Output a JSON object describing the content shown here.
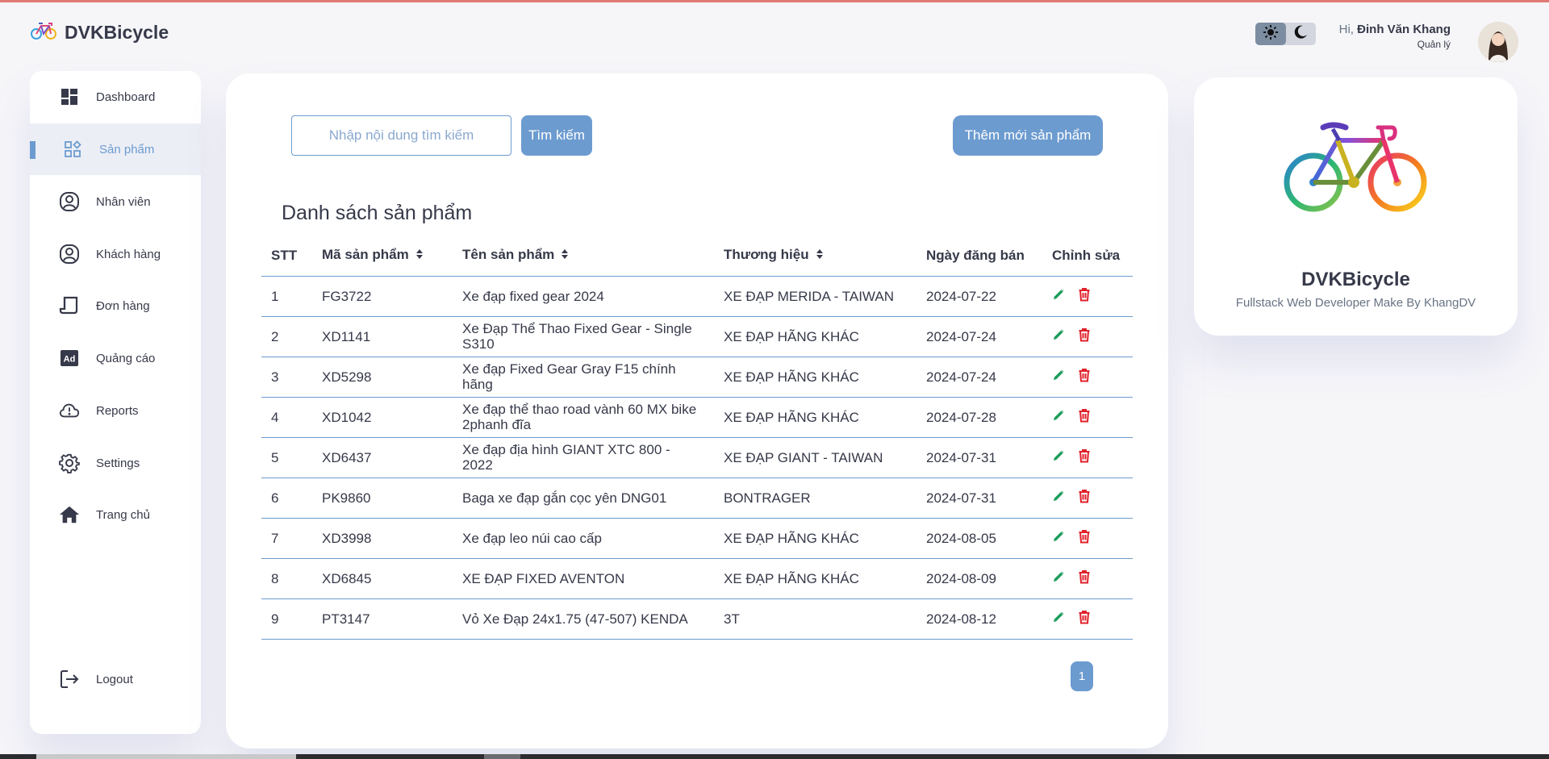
{
  "brand": {
    "title": "DVKBicycle"
  },
  "header": {
    "greeting_prefix": "Hi,",
    "user_name": "Đinh Văn Khang",
    "role": "Quản lý"
  },
  "sidebar": {
    "items": [
      {
        "label": "Dashboard",
        "icon": "dashboard-icon"
      },
      {
        "label": "Sản phẩm",
        "icon": "widgets-icon",
        "active": true
      },
      {
        "label": "Nhân viên",
        "icon": "person-icon"
      },
      {
        "label": "Khách hàng",
        "icon": "person-icon"
      },
      {
        "label": "Đơn hàng",
        "icon": "receipt-icon"
      },
      {
        "label": "Quảng cáo",
        "icon": "ad-icon"
      },
      {
        "label": "Reports",
        "icon": "report-cloud-icon"
      },
      {
        "label": "Settings",
        "icon": "gear-icon"
      },
      {
        "label": "Trang chủ",
        "icon": "home-icon"
      }
    ],
    "logout": "Logout"
  },
  "main": {
    "search_placeholder": "Nhập nội dung tìm kiếm",
    "search_button": "Tìm kiếm",
    "add_button": "Thêm mới sản phẩm",
    "list_title": "Danh sách sản phẩm",
    "columns": [
      "STT",
      "Mã sản phẩm",
      "Tên sản phẩm",
      "Thương hiệu",
      "Ngày đăng bán",
      "Chỉnh sửa"
    ],
    "rows": [
      {
        "stt": "1",
        "code": "FG3722",
        "name": "Xe đạp fixed gear 2024",
        "brand": "XE ĐẠP MERIDA - TAIWAN",
        "date": "2024-07-22"
      },
      {
        "stt": "2",
        "code": "XD1141",
        "name": "Xe Đạp Thể Thao Fixed Gear - Single S310",
        "brand": "XE ĐẠP HÃNG KHÁC",
        "date": "2024-07-24"
      },
      {
        "stt": "3",
        "code": "XD5298",
        "name": "Xe đạp Fixed Gear Gray F15 chính hãng",
        "brand": "XE ĐẠP HÃNG KHÁC",
        "date": "2024-07-24"
      },
      {
        "stt": "4",
        "code": "XD1042",
        "name": "Xe đạp thể thao road vành 60 MX bike 2phanh đĩa",
        "brand": "XE ĐẠP HÃNG KHÁC",
        "date": "2024-07-28"
      },
      {
        "stt": "5",
        "code": "XD6437",
        "name": "Xe đạp địa hình GIANT XTC 800 - 2022",
        "brand": "XE ĐẠP GIANT - TAIWAN",
        "date": "2024-07-31"
      },
      {
        "stt": "6",
        "code": "PK9860",
        "name": "Baga xe đạp gắn cọc yên DNG01",
        "brand": "BONTRAGER",
        "date": "2024-07-31"
      },
      {
        "stt": "7",
        "code": "XD3998",
        "name": "Xe đạp leo núi cao cấp",
        "brand": "XE ĐẠP HÃNG KHÁC",
        "date": "2024-08-05"
      },
      {
        "stt": "8",
        "code": "XD6845",
        "name": "XE ĐẠP FIXED AVENTON",
        "brand": "XE ĐẠP HÃNG KHÁC",
        "date": "2024-08-09"
      },
      {
        "stt": "9",
        "code": "PT3147",
        "name": "Vỏ Xe Đạp 24x1.75 (47-507) KENDA",
        "brand": "3T",
        "date": "2024-08-12"
      }
    ],
    "page": "1"
  },
  "side_card": {
    "title": "DVKBicycle",
    "subtitle": "Fullstack Web Developer Make By KhangDV"
  },
  "colors": {
    "primary": "#6c9bcf",
    "edit": "#1b9c5a",
    "delete": "#e0212b",
    "background": "#f6f6f9"
  }
}
